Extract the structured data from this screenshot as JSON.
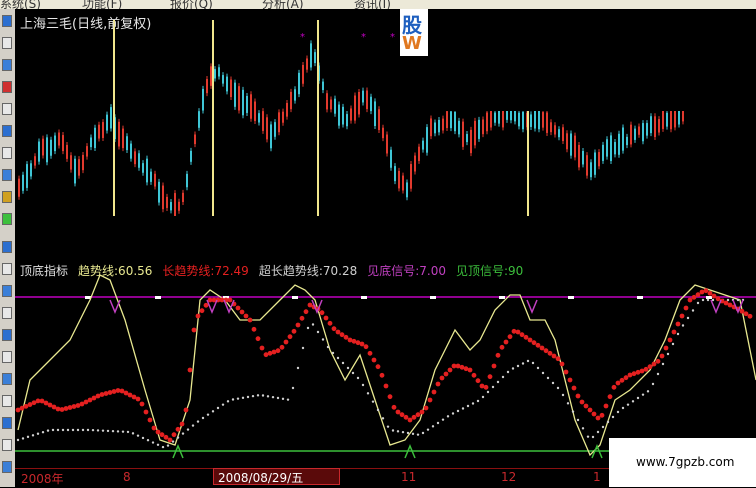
{
  "menu": {
    "items": [
      {
        "label": "系统(S)",
        "x_note": ""
      },
      {
        "label": "功能(F)"
      },
      {
        "label": "报价(Q)"
      },
      {
        "label": "分析(A)"
      },
      {
        "label": "资讯(I)"
      }
    ]
  },
  "stock": {
    "name": "上海三毛",
    "title": "上海三毛(日线,前复权)"
  },
  "indicator": {
    "name": "顶底指标",
    "mid_trend_label": "趋势线:60.56",
    "long_trend_label": "长趋势线:72.49",
    "ultra_trend_label": "超长趋势线:70.28",
    "bottom_signal_label": "见底信号:7.00",
    "top_signal_label": "见顶信号:90"
  },
  "axis": {
    "labels": [
      "2008年",
      "8",
      "11",
      "12",
      "1"
    ],
    "cursor_date": "2008/08/29/五"
  },
  "ad": {
    "line1": "股",
    "line2": "W"
  },
  "watermark": {
    "text": "www.7gpzb.com"
  },
  "colors": {
    "up": "#e23a2e",
    "down": "#3fc6d6",
    "vline": "#f0e68c",
    "top_line": "#c000c0",
    "bottom_line": "#3cbf3c",
    "trend": "#e8e890",
    "long_trend": "#e42020",
    "ultra_trend": "#d0d0d0"
  }
}
